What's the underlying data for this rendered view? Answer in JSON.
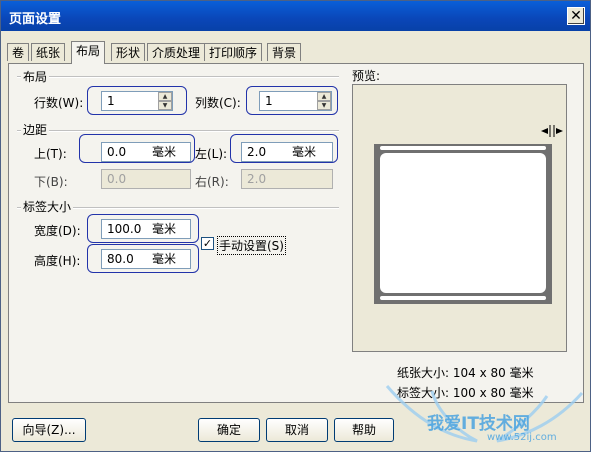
{
  "window": {
    "title": "页面设置",
    "close_glyph": "✕"
  },
  "tabs": [
    "卷",
    "纸张",
    "布局",
    "形状",
    "介质处理",
    "打印顺序",
    "背景"
  ],
  "layout": {
    "group_label": "布局",
    "rows_label": "行数(W):",
    "rows_value": "1",
    "cols_label": "列数(C):",
    "cols_value": "1"
  },
  "margins": {
    "group_label": "边距",
    "top_label": "上(T):",
    "top_value": "0.0",
    "top_unit": "毫米",
    "left_label": "左(L):",
    "left_value": "2.0",
    "left_unit": "毫米",
    "bottom_label": "下(B):",
    "bottom_value": "0.0",
    "right_label": "右(R):",
    "right_value": "2.0"
  },
  "label_size": {
    "group_label": "标签大小",
    "width_label": "宽度(D):",
    "width_value": "100.0",
    "width_unit": "毫米",
    "height_label": "高度(H):",
    "height_value": "80.0",
    "height_unit": "毫米",
    "manual_label": "手动设置(S)",
    "manual_checked": "✓"
  },
  "preview": {
    "label": "预览:",
    "paper_size": "纸张大小: 104 x 80 毫米",
    "label_size": "标签大小: 100 x 80 毫米"
  },
  "buttons": {
    "wizard": "向导(Z)...",
    "ok": "确定",
    "cancel": "取消",
    "help": "帮助"
  },
  "watermark": {
    "text": "我爱IT技术网",
    "url": "www.52ij.com"
  },
  "colors": {
    "titlebar": "#0a46b8",
    "highlight": "#2233aa",
    "watermark": "#4aa3e0"
  }
}
